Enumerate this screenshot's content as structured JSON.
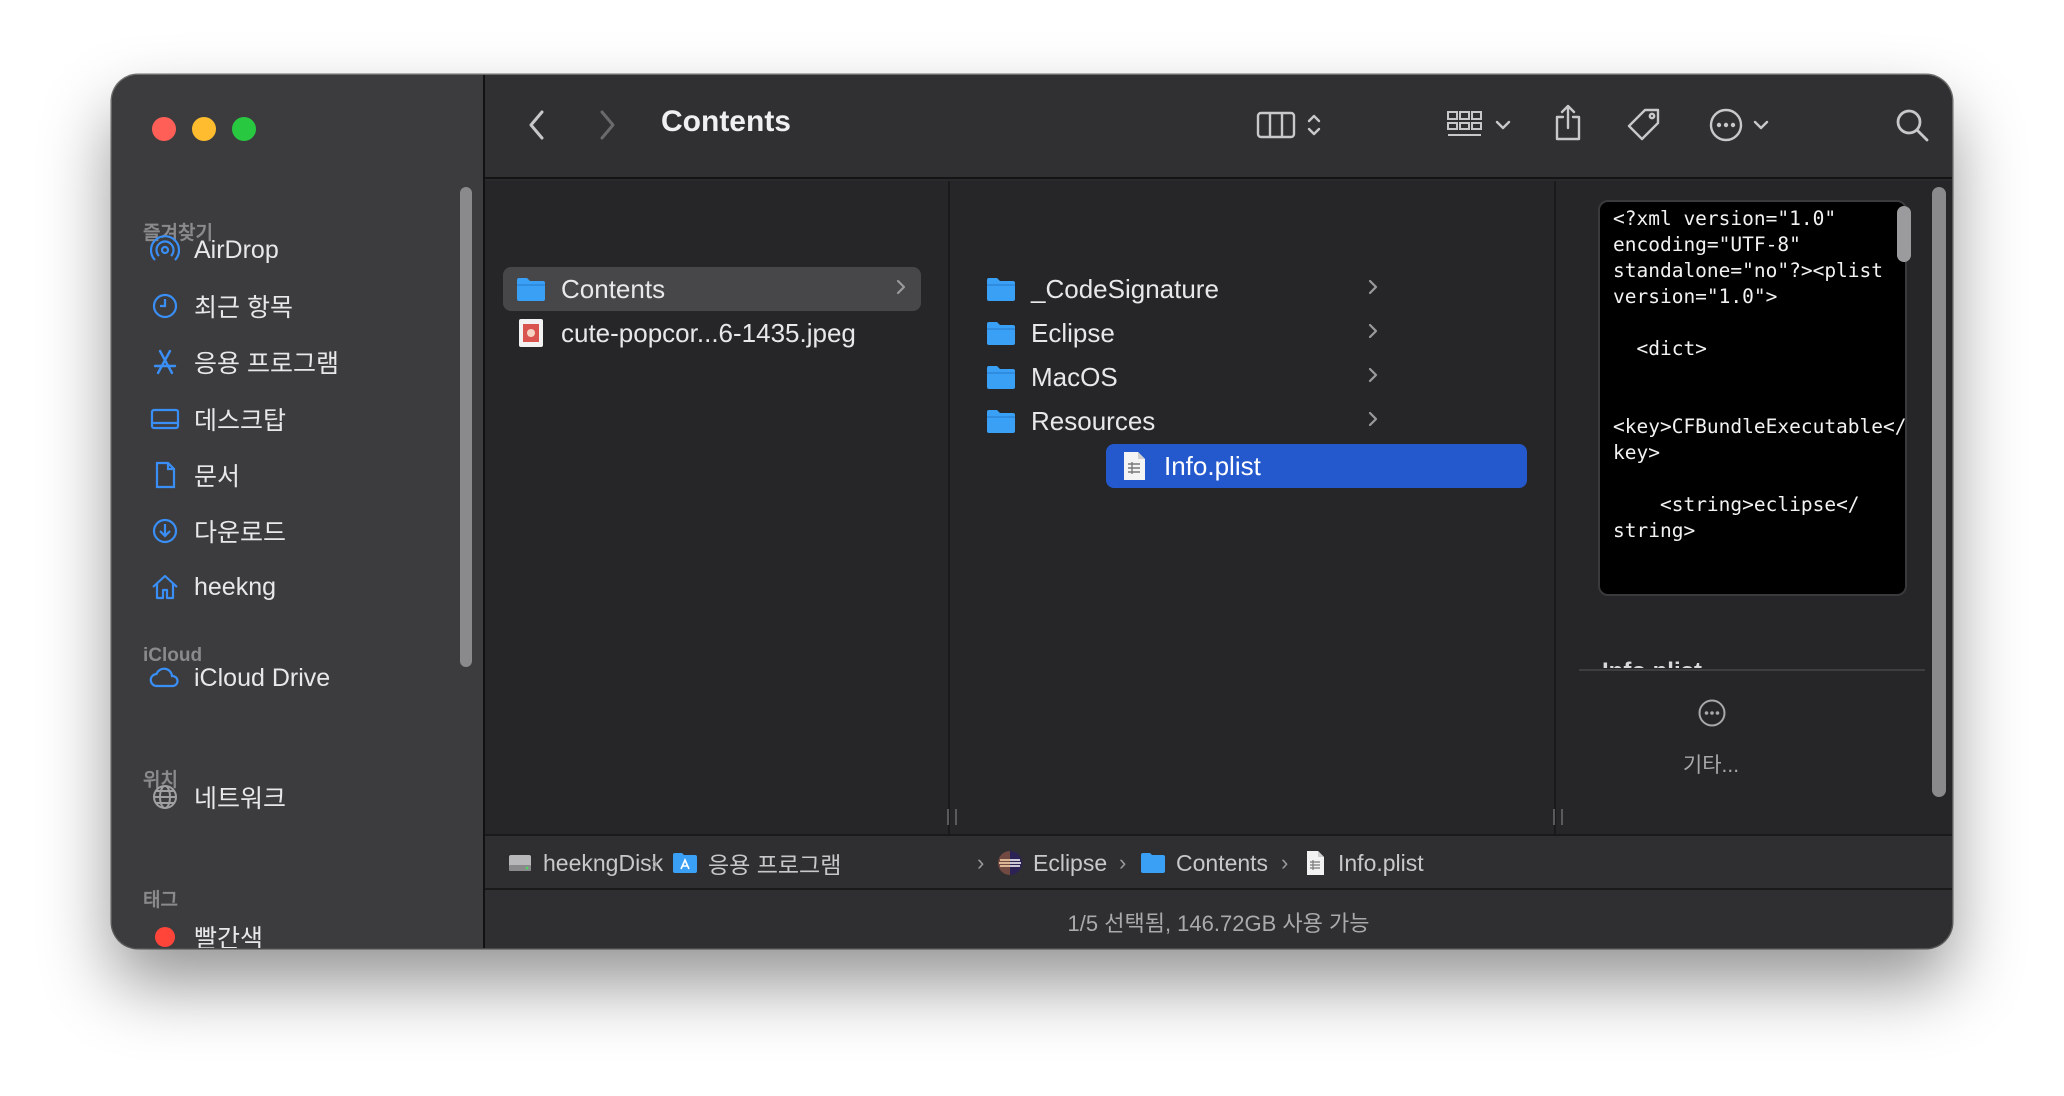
{
  "window": {
    "title": "Contents"
  },
  "sidebar": {
    "sections": [
      {
        "label": "즐겨찾기",
        "items": [
          {
            "label": "AirDrop",
            "icon": "airdrop-icon"
          },
          {
            "label": "최근 항목",
            "icon": "clock-icon"
          },
          {
            "label": "응용 프로그램",
            "icon": "applications-icon"
          },
          {
            "label": "데스크탑",
            "icon": "desktop-icon"
          },
          {
            "label": "문서",
            "icon": "document-icon"
          },
          {
            "label": "다운로드",
            "icon": "download-icon"
          },
          {
            "label": "heekng",
            "icon": "home-icon"
          }
        ]
      },
      {
        "label": "iCloud",
        "items": [
          {
            "label": "iCloud Drive",
            "icon": "cloud-icon"
          }
        ]
      },
      {
        "label": "위치",
        "items": [
          {
            "label": "네트워크",
            "icon": "network-icon"
          }
        ]
      },
      {
        "label": "태그",
        "items": [
          {
            "label": "빨간색",
            "icon": "red-tag-dot",
            "color": "#ff453a"
          }
        ]
      }
    ]
  },
  "toolbar": {
    "back_icon": "chevron-left-icon",
    "forward_icon": "chevron-right-icon",
    "view_icon": "column-view-icon",
    "group_icon": "group-grid-icon",
    "share_icon": "share-icon",
    "tag_icon": "tag-icon",
    "action_icon": "ellipsis-circle-icon",
    "search_icon": "search-icon"
  },
  "columns": [
    {
      "items": [
        {
          "name": "Contents",
          "type": "folder",
          "has_children": true,
          "state": "highlighted"
        },
        {
          "name": "cute-popcor...6-1435.jpeg",
          "type": "image",
          "has_children": false,
          "state": "normal"
        }
      ]
    },
    {
      "items": [
        {
          "name": "_CodeSignature",
          "type": "folder",
          "has_children": true,
          "state": "normal"
        },
        {
          "name": "Eclipse",
          "type": "folder",
          "has_children": true,
          "state": "normal"
        },
        {
          "name": "MacOS",
          "type": "folder",
          "has_children": true,
          "state": "normal"
        },
        {
          "name": "Resources",
          "type": "folder",
          "has_children": true,
          "state": "normal"
        },
        {
          "name": "Info.plist",
          "type": "file",
          "has_children": false,
          "state": "selected"
        }
      ]
    }
  ],
  "preview": {
    "code": "<?xml version=\"1.0\"\nencoding=\"UTF-8\"\nstandalone=\"no\"?><plist\nversion=\"1.0\">\n\n  <dict>\n\n\n<key>CFBundleExecutable</\nkey>\n\n    <string>eclipse</\nstring>",
    "filename": "Info.plist",
    "more_label": "기타..."
  },
  "pathbar": {
    "crumbs": [
      {
        "label": "heekngDisk",
        "icon": "disk-icon"
      },
      {
        "label": "응용 프로그램",
        "icon": "applications-folder-icon"
      },
      {
        "label": "Eclipse",
        "icon": "eclipse-app-icon"
      },
      {
        "label": "Contents",
        "icon": "folder-icon"
      },
      {
        "label": "Info.plist",
        "icon": "file-icon"
      }
    ]
  },
  "status": {
    "text": "1/5 선택됨, 146.72GB 사용 가능"
  },
  "colors": {
    "accent_blue": "#2459ce",
    "folder_blue": "#3aa0f5",
    "sidebar_icon_blue": "#3a8ff7"
  }
}
